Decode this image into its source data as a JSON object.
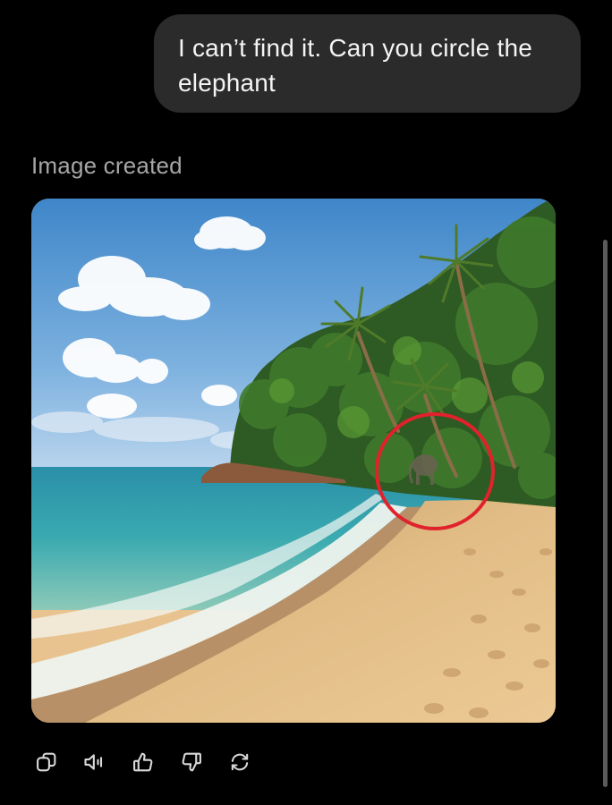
{
  "message": {
    "user_text": "I can’t find it. Can you circle the elephant"
  },
  "response": {
    "status_label": "Image created",
    "image": {
      "scene": "tropical-beach-with-palm-trees",
      "highlight_circle_color": "#e0222c"
    }
  },
  "actions": [
    {
      "name": "copy-button",
      "icon": "copy-icon"
    },
    {
      "name": "read-aloud-button",
      "icon": "speaker-icon"
    },
    {
      "name": "thumbs-up-button",
      "icon": "thumbs-up-icon"
    },
    {
      "name": "thumbs-down-button",
      "icon": "thumbs-down-icon"
    },
    {
      "name": "regenerate-button",
      "icon": "regenerate-icon"
    }
  ],
  "colors": {
    "background": "#000000",
    "bubble": "#2b2b2b",
    "muted_text": "#a6a6a6"
  }
}
